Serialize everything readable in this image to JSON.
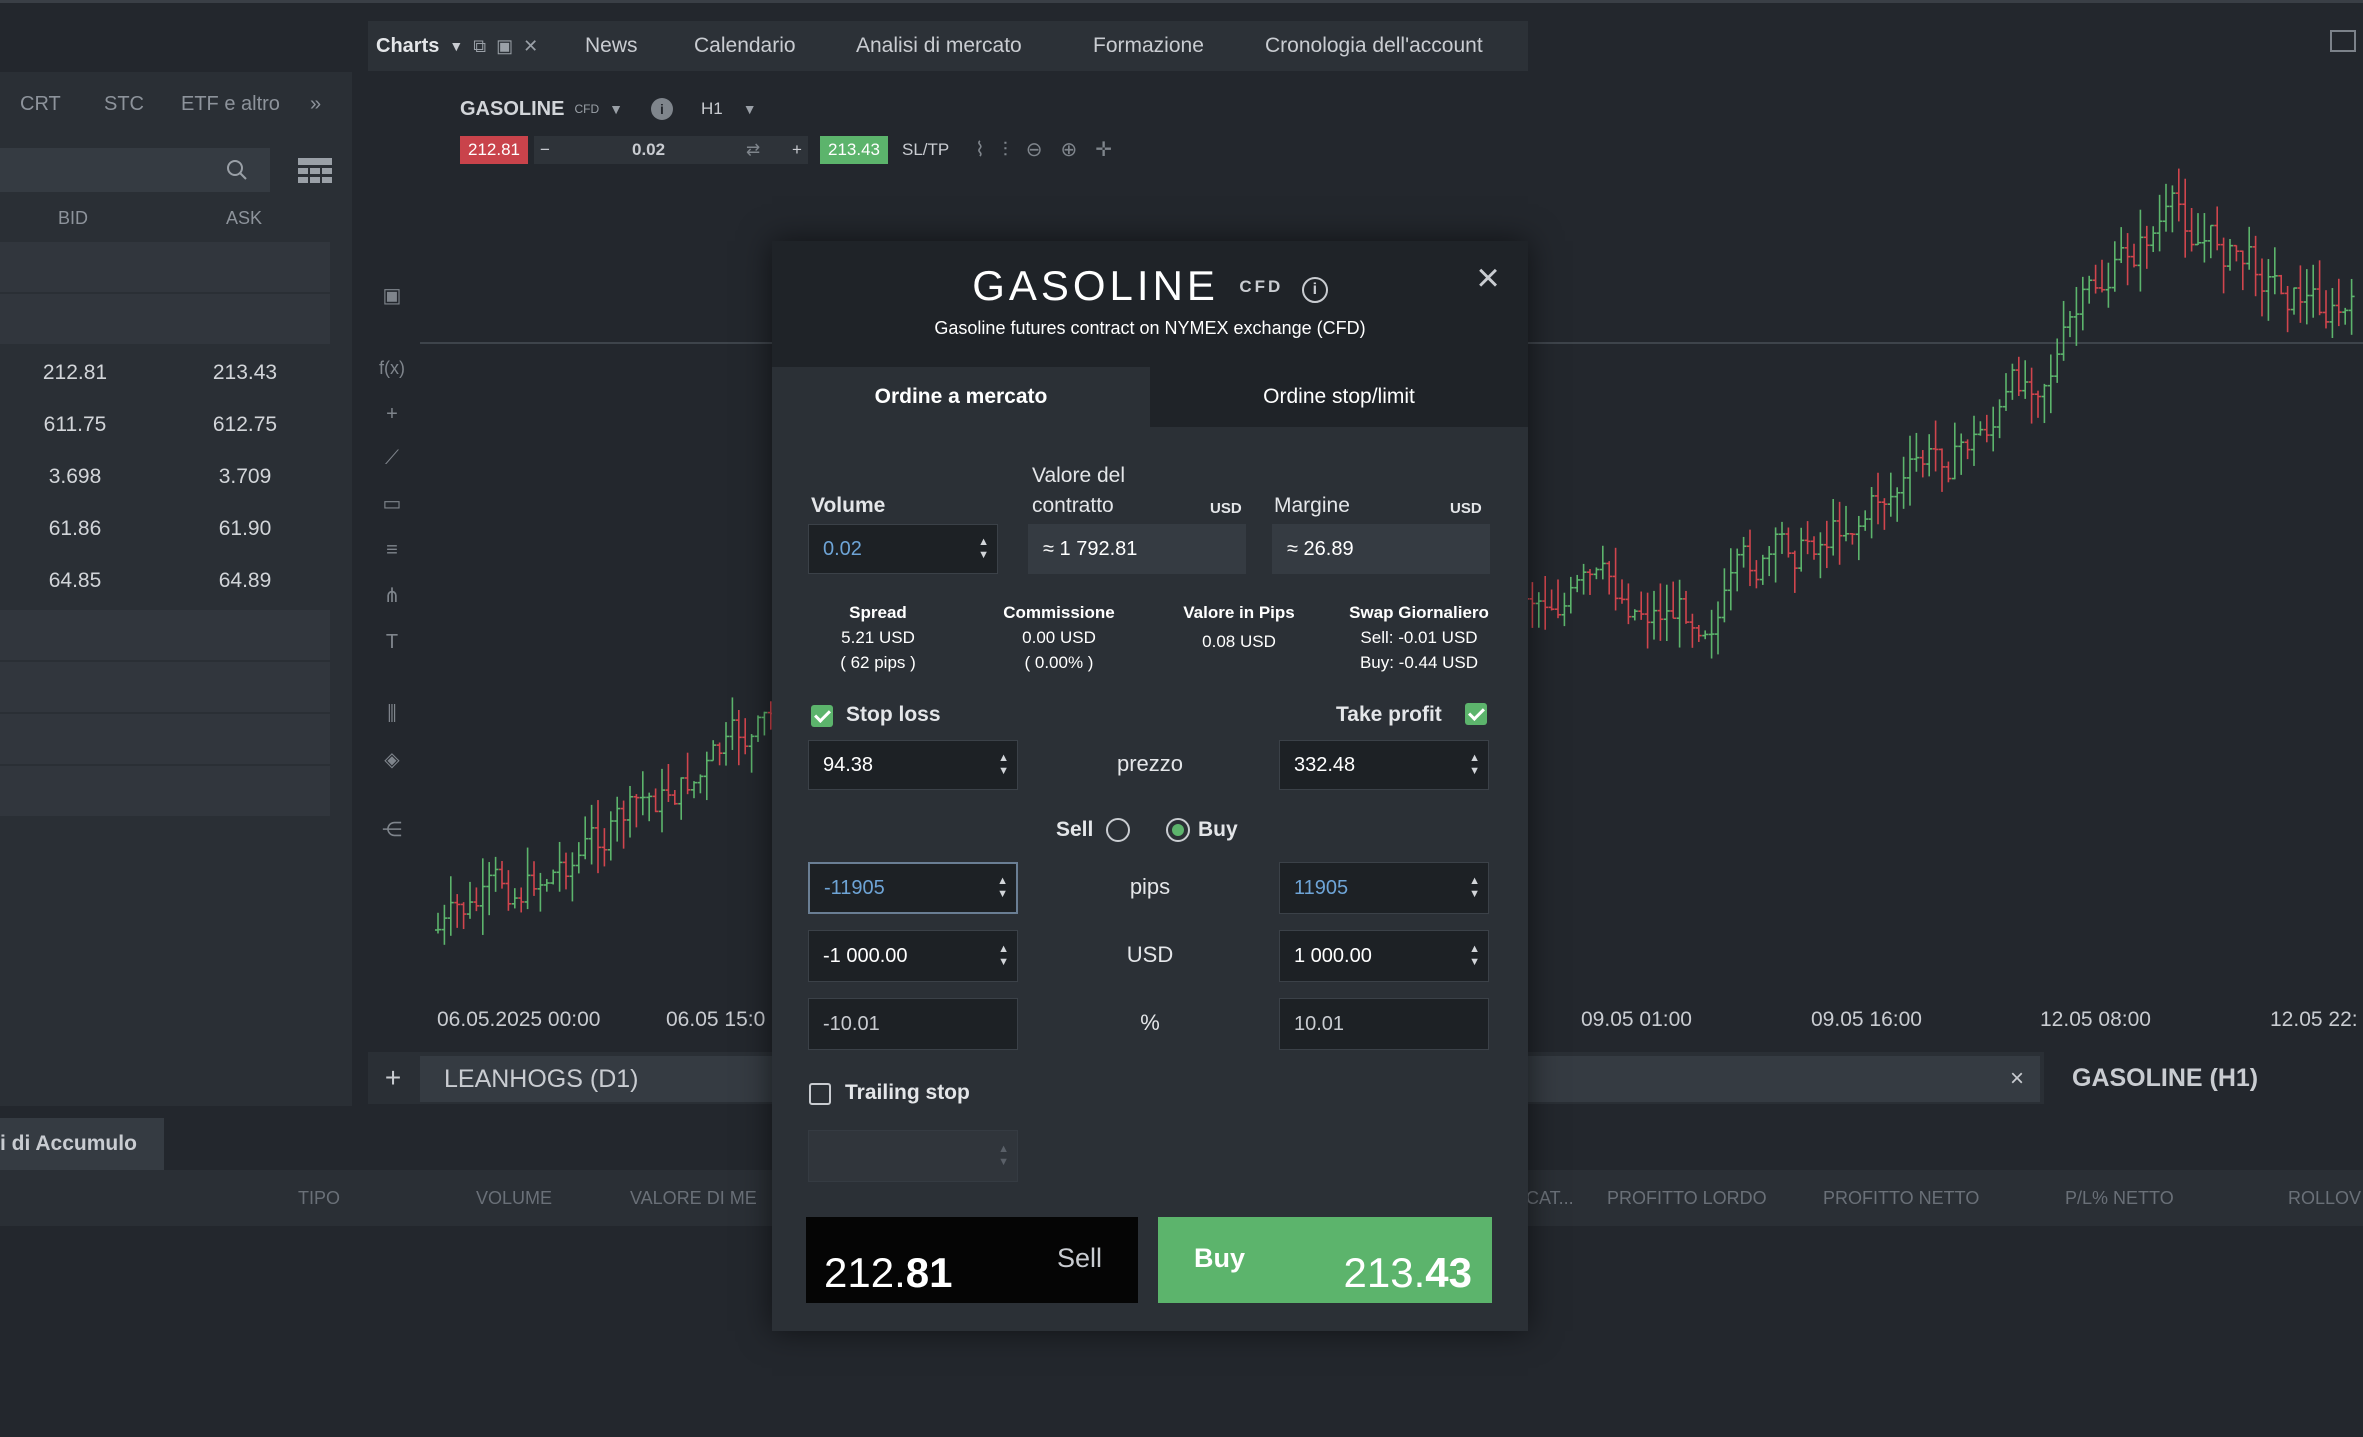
{
  "topnav": {
    "charts_label": "Charts",
    "tabs": [
      "News",
      "Calendario",
      "Analisi di mercato",
      "Formazione",
      "Cronologia dell'account"
    ]
  },
  "left_panel": {
    "tabs": [
      "CRT",
      "STC",
      "ETF e altro"
    ],
    "columns": [
      "BID",
      "ASK"
    ],
    "rows": [
      {
        "bid": "",
        "ask": ""
      },
      {
        "bid": "",
        "ask": ""
      },
      {
        "bid": "212.81",
        "ask": "213.43"
      },
      {
        "bid": "611.75",
        "ask": "612.75"
      },
      {
        "bid": "3.698",
        "ask": "3.709"
      },
      {
        "bid": "61.86",
        "ask": "61.90"
      },
      {
        "bid": "64.85",
        "ask": "64.89"
      },
      {
        "bid": "",
        "ask": ""
      },
      {
        "bid": "",
        "ask": ""
      },
      {
        "bid": "",
        "ask": ""
      },
      {
        "bid": "",
        "ask": ""
      }
    ]
  },
  "chart": {
    "instrument": "GASOLINE",
    "instrument_type": "CFD",
    "timeframe": "H1",
    "bid": "212.81",
    "volume": "0.02",
    "ask": "213.43",
    "sltp_label": "SL/TP",
    "x_ticks": [
      "06.05.2025 00:00",
      "06.05 15:0",
      "09.05 01:00",
      "09.05 16:00",
      "12.05 08:00",
      "12.05 22:"
    ],
    "colors": {
      "up": "#5cb46c",
      "down": "#d0454d"
    },
    "tabs": {
      "leanhogs": "LEANHOGS (D1)",
      "gasoline": "GASOLINE (H1)",
      "close": "×",
      "add": "+"
    }
  },
  "bottom": {
    "tab": "i di Accumulo",
    "columns": [
      "TIPO",
      "VOLUME",
      "VALORE DI ME",
      "CAT...",
      "PROFITTO LORDO",
      "PROFITTO NETTO",
      "P/L% NETTO",
      "ROLLOV"
    ]
  },
  "modal": {
    "title": "GASOLINE",
    "badge": "CFD",
    "subtitle": "Gasoline futures contract on NYMEX exchange (CFD)",
    "tabs": {
      "market": "Ordine a mercato",
      "stop": "Ordine stop/limit"
    },
    "volume_label": "Volume",
    "volume_value": "0.02",
    "contract_label_1": "Valore del",
    "contract_label_2": "contratto",
    "contract_unit": "USD",
    "contract_value": "≈ 1 792.81",
    "margin_label": "Margine",
    "margin_unit": "USD",
    "margin_value": "≈ 26.89",
    "stats": {
      "spread": {
        "label": "Spread",
        "line1": "5.21 USD",
        "line2": "( 62 pips )"
      },
      "commission": {
        "label": "Commissione",
        "line1": "0.00 USD",
        "line2": "( 0.00% )"
      },
      "pip_value": {
        "label": "Valore in Pips",
        "line1": "0.08 USD"
      },
      "swap": {
        "label": "Swap Giornaliero",
        "line1": "Sell: -0.01 USD",
        "line2": "Buy: -0.44 USD"
      }
    },
    "stop_loss_label": "Stop loss",
    "take_profit_label": "Take profit",
    "price_label": "prezzo",
    "sl_price": "94.38",
    "tp_price": "332.48",
    "sell_label": "Sell",
    "buy_label": "Buy",
    "pips_label": "pips",
    "sl_pips": "-11905",
    "tp_pips": "11905",
    "usd_label": "USD",
    "sl_usd": "-1 000.00",
    "tp_usd": "1 000.00",
    "pct_label": "%",
    "sl_pct": "-10.01",
    "tp_pct": "10.01",
    "trailing_label": "Trailing stop",
    "sell_button": {
      "label": "Sell",
      "price_main": "212.",
      "price_bold": "81"
    },
    "buy_button": {
      "label": "Buy",
      "price_main": "213.",
      "price_bold": "43"
    },
    "colors": {
      "accent_green": "#5cb46c",
      "value_blue": "#6ea4d6"
    }
  }
}
